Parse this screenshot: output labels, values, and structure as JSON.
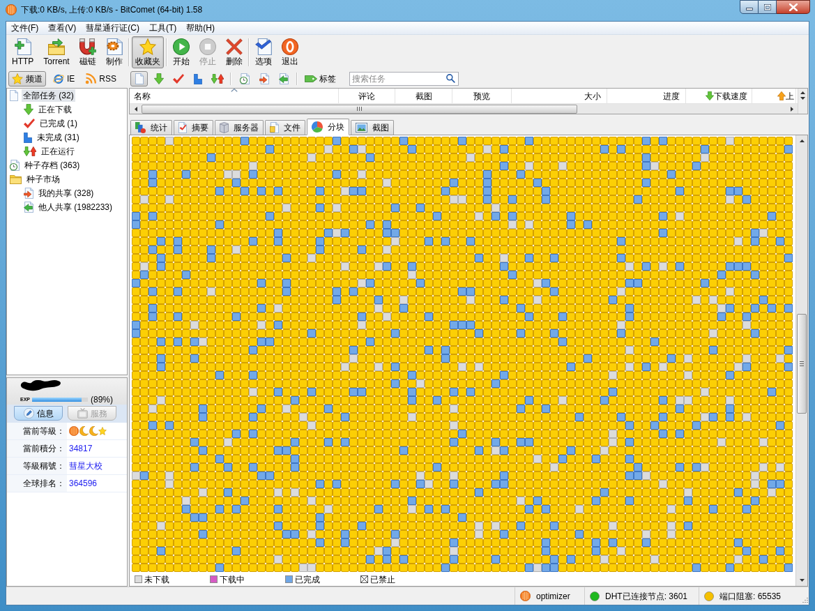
{
  "window": {
    "title": "下载:0 KB/s, 上传:0 KB/s - BitComet (64-bit) 1.58"
  },
  "menu": [
    "文件(F)",
    "查看(V)",
    "彗星通行证(C)",
    "工具(T)",
    "帮助(H)"
  ],
  "toolbar_groups": [
    {
      "buttons": [
        {
          "label": "HTTP",
          "selected": false,
          "disabled": false
        },
        {
          "label": "Torrent",
          "selected": false,
          "disabled": false
        },
        {
          "label": "磁链",
          "selected": false,
          "disabled": false
        },
        {
          "label": "制作",
          "selected": false,
          "disabled": false
        }
      ]
    },
    {
      "buttons": [
        {
          "label": "收藏夹",
          "selected": true,
          "disabled": false
        }
      ]
    },
    {
      "buttons": [
        {
          "label": "开始",
          "selected": false,
          "disabled": false
        },
        {
          "label": "停止",
          "selected": false,
          "disabled": true
        },
        {
          "label": "删除",
          "selected": false,
          "disabled": false
        }
      ]
    },
    {
      "buttons": [
        {
          "label": "选项",
          "selected": false,
          "disabled": false
        },
        {
          "label": "退出",
          "selected": false,
          "disabled": false
        }
      ]
    }
  ],
  "channel_tabs": [
    {
      "label": "频道",
      "selected": true
    },
    {
      "label": "IE",
      "selected": false
    },
    {
      "label": "RSS",
      "selected": false
    }
  ],
  "task_filters": [
    {
      "selected": true
    },
    {
      "selected": false
    },
    {
      "selected": false
    },
    {
      "selected": false
    },
    {
      "selected": false
    }
  ],
  "tag_button": {
    "label": "标签"
  },
  "search": {
    "placeholder": "搜索任务"
  },
  "sidebar_tree": [
    {
      "label": "全部任务 (32)",
      "selected": true,
      "children": [
        {
          "label": "正在下载",
          "selected": false
        },
        {
          "label": "已完成 (1)",
          "selected": false
        },
        {
          "label": "未完成 (31)",
          "selected": false
        },
        {
          "label": "正在运行",
          "selected": false
        }
      ]
    },
    {
      "label": "种子存档 (363)",
      "selected": false
    },
    {
      "label": "种子市场",
      "selected": false,
      "children": [
        {
          "label": "我的共享 (328)",
          "selected": false
        },
        {
          "label": "他人共享 (1982233)",
          "selected": false
        }
      ]
    }
  ],
  "profile": {
    "exp_label": "EXP",
    "exp": {
      "level": 0.89
    },
    "exp_reading": "(89%)",
    "tabs": [
      {
        "label": "信息",
        "selected": true,
        "disabled": false
      },
      {
        "label": "服務",
        "selected": false,
        "disabled": true
      }
    ],
    "rows": [
      {
        "kind": "badges",
        "label": "當前等級："
      },
      {
        "kind": "text",
        "label": "當前積分：",
        "value": "34817"
      },
      {
        "kind": "text",
        "label": "等級稱號：",
        "value": "彗星大校"
      },
      {
        "kind": "text",
        "label": "全球排名：",
        "value": "364596"
      }
    ]
  },
  "task_list": {
    "columns": [
      {
        "label": "名称",
        "kind": "plain",
        "sorted": true
      },
      {
        "label": "评论",
        "kind": "plain",
        "sorted": false
      },
      {
        "label": "截图",
        "kind": "plain",
        "sorted": false
      },
      {
        "label": "预览",
        "kind": "plain",
        "sorted": false
      },
      {
        "label": "大小",
        "kind": "plain",
        "sorted": false
      },
      {
        "label": "进度",
        "kind": "plain",
        "sorted": false
      },
      {
        "label": "下载速度",
        "kind": "download",
        "sorted": false
      },
      {
        "label": "上",
        "kind": "upload",
        "sorted": false
      }
    ]
  },
  "detail_tabs": [
    {
      "label": "统计",
      "selected": false
    },
    {
      "label": "摘要",
      "selected": false
    },
    {
      "label": "服务器",
      "selected": false
    },
    {
      "label": "文件",
      "selected": false
    },
    {
      "label": "分块",
      "selected": true
    },
    {
      "label": "截图",
      "selected": false
    }
  ],
  "piece_legend": [
    {
      "label": "未下载",
      "kind": "swatch",
      "color": "#dcdcdc"
    },
    {
      "label": "下载中",
      "kind": "swatch",
      "color": "#d65bc4"
    },
    {
      "label": "已完成",
      "kind": "swatch",
      "color": "#6fa6e6"
    },
    {
      "label": "已禁止",
      "kind": "crossed"
    }
  ],
  "status_bar": [
    {
      "kind": "logo",
      "label": "optimizer"
    },
    {
      "kind": "dot",
      "color": "#1fb81f",
      "label": "DHT已连接节点: 3601"
    },
    {
      "kind": "dot",
      "color": "#f5c000",
      "label": "端口阻塞: 65535"
    }
  ]
}
